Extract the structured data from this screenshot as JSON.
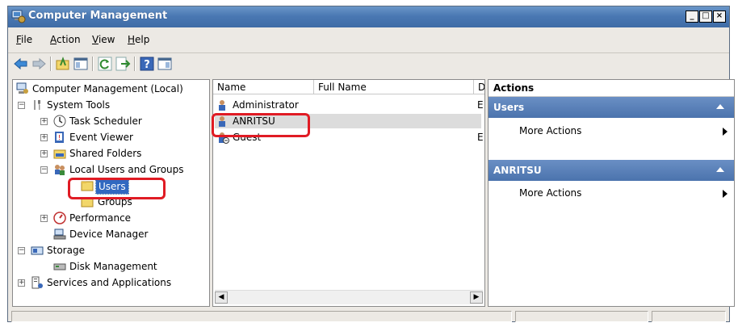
{
  "window": {
    "title": "Computer Management",
    "controls": [
      "minimize",
      "maximize",
      "close"
    ]
  },
  "menubar": {
    "items": [
      {
        "label": "ile",
        "mnemonic": "F"
      },
      {
        "label": "ction",
        "mnemonic": "A"
      },
      {
        "label": "iew",
        "mnemonic": "V"
      },
      {
        "label": "elp",
        "mnemonic": "H"
      }
    ]
  },
  "toolbar": {
    "icons": [
      "back-icon",
      "forward-icon",
      "up-folder-icon",
      "show-hide-tree-icon",
      "refresh-icon",
      "export-list-icon",
      "help-icon",
      "show-hide-action-pane-icon"
    ]
  },
  "tree": {
    "root": "Computer Management (Local)",
    "system_tools": "System Tools",
    "task_scheduler": "Task Scheduler",
    "event_viewer": "Event Viewer",
    "shared_folders": "Shared Folders",
    "local_users_groups": "Local Users and Groups",
    "users": "Users",
    "groups": "Groups",
    "performance": "Performance",
    "device_manager": "Device Manager",
    "storage": "Storage",
    "disk_management": "Disk Management",
    "services_apps": "Services and Applications"
  },
  "list": {
    "columns": [
      "Name",
      "Full Name",
      "D"
    ],
    "rows": [
      {
        "name": "Administrator",
        "full_name": "",
        "desc": "E"
      },
      {
        "name": "ANRITSU",
        "full_name": "",
        "desc": ""
      },
      {
        "name": "Guest",
        "full_name": "",
        "desc": "E"
      }
    ]
  },
  "actions": {
    "title": "Actions",
    "sections": [
      {
        "header": "Users",
        "item": "More Actions"
      },
      {
        "header": "ANRITSU",
        "item": "More Actions"
      }
    ]
  },
  "colors": {
    "titlebar": "#4a78b3",
    "action_header": "#5a80b8",
    "highlight": "#e01b24",
    "selected_tree": "#3168c0"
  }
}
